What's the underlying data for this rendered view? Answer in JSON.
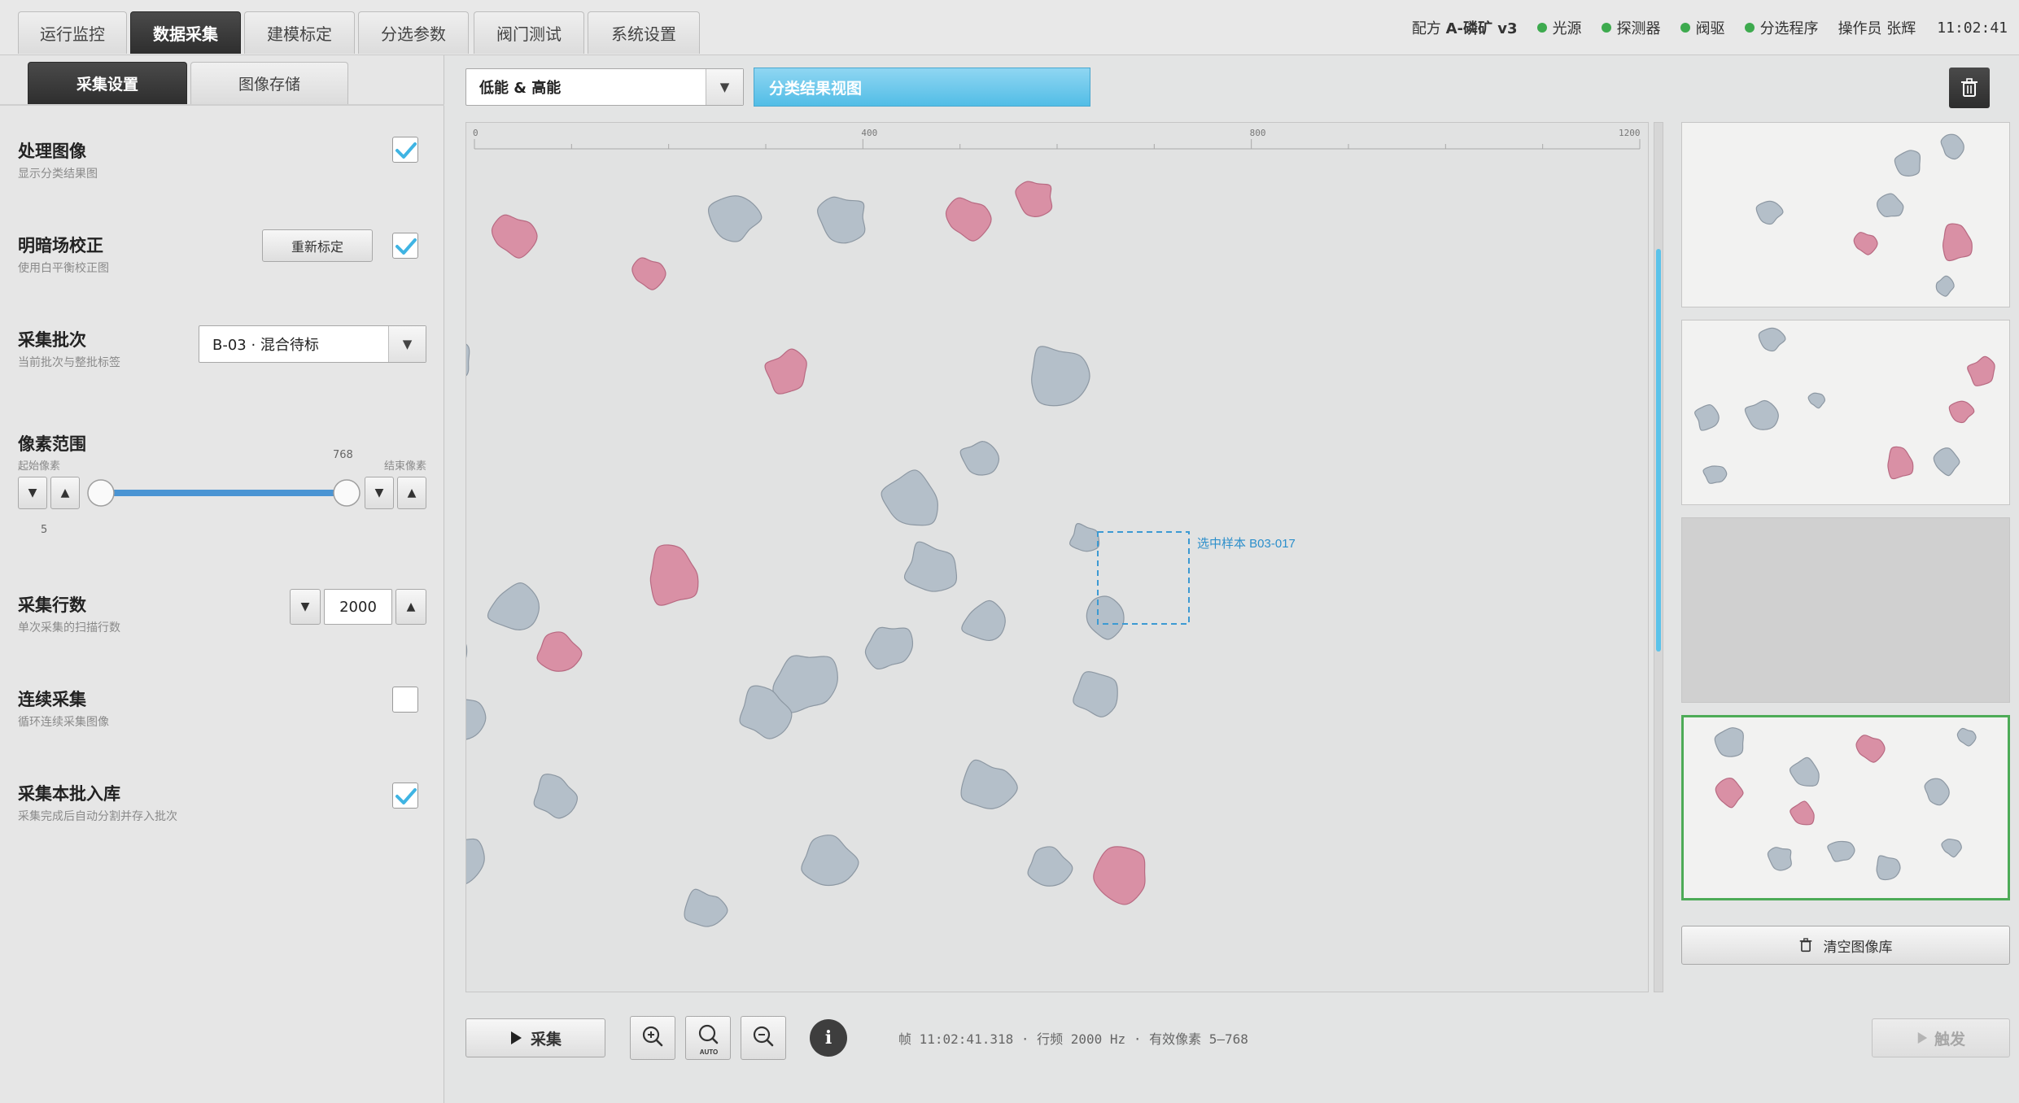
{
  "main_tabs": [
    {
      "label": "运行监控"
    },
    {
      "label": "数据采集"
    },
    {
      "label": "建模标定"
    },
    {
      "label": "分选参数"
    },
    {
      "label": "阀门测试"
    },
    {
      "label": "系统设置"
    }
  ],
  "status": {
    "recipe_prefix": "配方 ",
    "recipe_name": "A-磷矿 v3",
    "indicators": [
      {
        "label": "光源"
      },
      {
        "label": "探测器"
      },
      {
        "label": "阀驱"
      },
      {
        "label": "分选程序"
      }
    ],
    "operator": "操作员 张辉",
    "time": "11:02:41",
    "ok_color": "#3daa4e"
  },
  "sub_tabs": [
    {
      "label": "采集设置"
    },
    {
      "label": "图像存储"
    }
  ],
  "settings": {
    "process_image": {
      "title": "处理图像",
      "desc": "显示分类结果图",
      "checked": true
    },
    "flat_field": {
      "title": "明暗场校正",
      "desc": "使用白平衡校正图",
      "button": "重新标定",
      "checked": true
    },
    "batch": {
      "title": "采集批次",
      "desc": "当前批次与整批标签",
      "value": "B-03 · 混合待标"
    },
    "pixel_range": {
      "title": "像素范围",
      "start_label": "起始像素",
      "end_label": "结束像素",
      "start_value": "5",
      "end_value": "768",
      "min": 0,
      "max": 768,
      "start": 5,
      "end": 768
    },
    "scan_lines": {
      "title": "采集行数",
      "desc": "单次采集的扫描行数",
      "value": "2000"
    },
    "continuous": {
      "title": "连续采集",
      "desc": "循环连续采集图像",
      "checked": false
    },
    "save_batch": {
      "title": "采集本批入库",
      "desc": "采集完成后自动分割并存入批次",
      "checked": true
    }
  },
  "view": {
    "channel_select": "低能 & 高能",
    "mode_button": "分类结果视图",
    "ruler_ticks": [
      "0",
      "400",
      "800",
      "1200"
    ],
    "selection_label": "选中样本 B03-017",
    "accent": "#5bc3ea",
    "gray_color": "#b4bfc9",
    "pink_color": "#d990a5"
  },
  "library": {
    "clear_button": "清空图像库"
  },
  "bottom": {
    "capture_button": "采集",
    "zoom_auto_label": "AUTO",
    "info_label": "i",
    "frame_info": "帧 11:02:41.318 · 行频 2000 Hz · 有效像素 5–768",
    "trigger_button": "触发"
  }
}
